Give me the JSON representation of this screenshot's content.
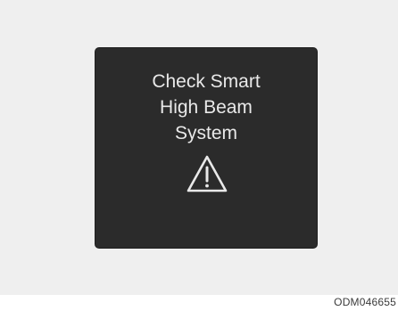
{
  "display": {
    "message_lines": [
      "Check Smart",
      "High Beam",
      "System"
    ],
    "icon": "warning-triangle-icon"
  },
  "figure_code": "ODM046655",
  "colors": {
    "background": "#efefef",
    "display": "#2b2b2b",
    "text": "#e9e9e9"
  }
}
